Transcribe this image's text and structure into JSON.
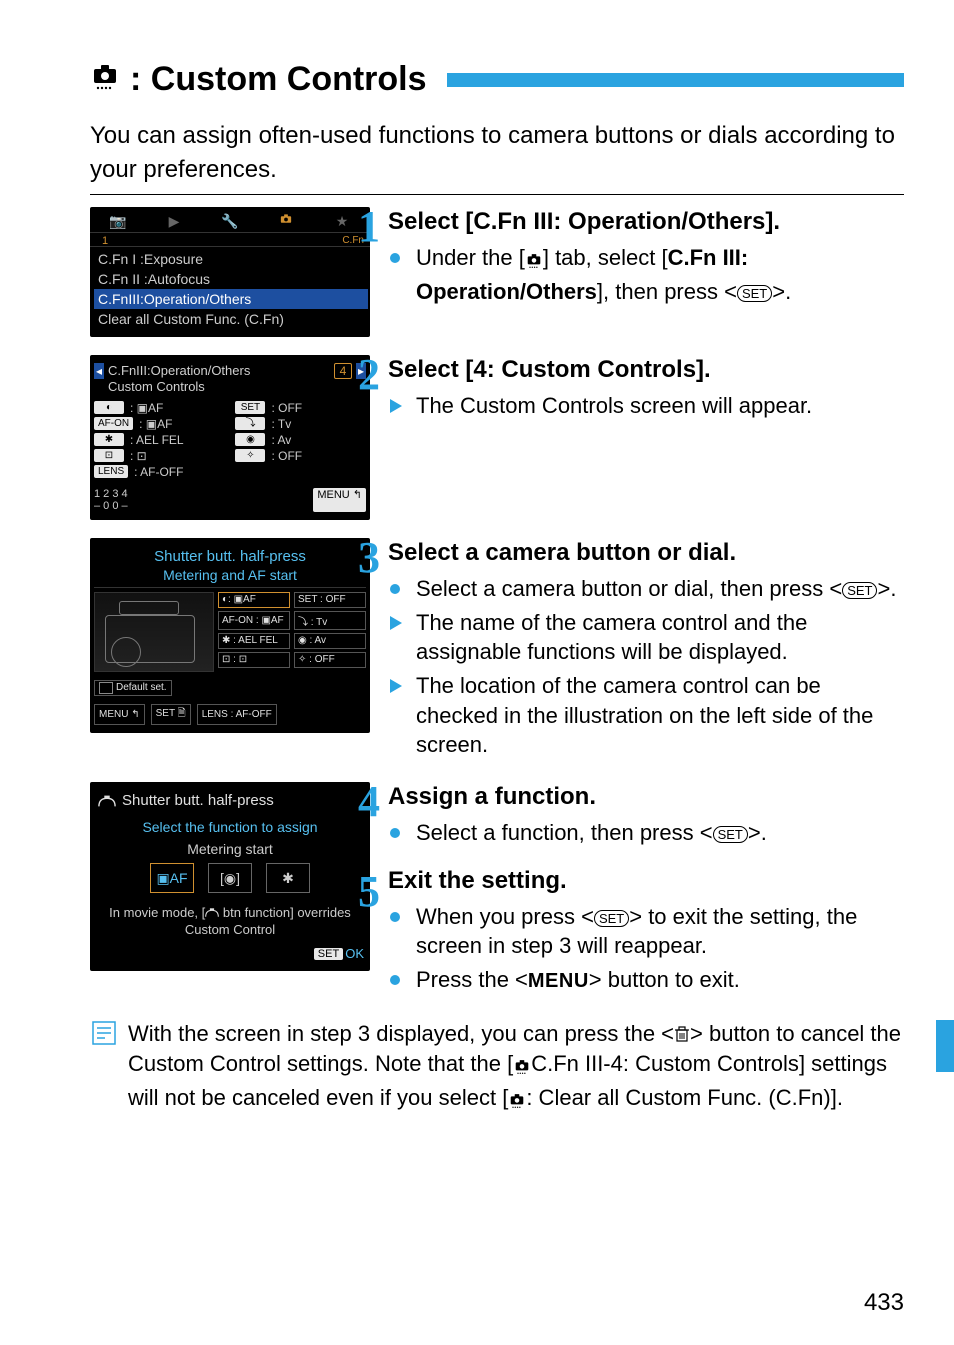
{
  "page_number": "433",
  "title_text": ": Custom Controls",
  "intro": "You can assign often-used functions to camera buttons or dials according to your preferences.",
  "icons": {
    "cfn_tab": "custom-functions-tab-icon",
    "set_button": "SET",
    "menu_button": "MENU",
    "trash": "trash-icon",
    "shutter": "shutter-half-press-icon"
  },
  "steps": [
    {
      "num": "1",
      "head": "Select [C.Fn III: Operation/Others].",
      "bullets": [
        {
          "kind": "dot",
          "pre": "Under the [",
          "mid": "] tab, select [",
          "bold": "C.Fn III: Operation/Others",
          "post": "], then press <",
          "post2": ">."
        }
      ]
    },
    {
      "num": "2",
      "head": "Select [4: Custom Controls].",
      "bullets": [
        {
          "kind": "tri",
          "text": "The Custom Controls screen will appear."
        }
      ]
    },
    {
      "num": "3",
      "head": "Select a camera button or dial.",
      "bullets": [
        {
          "kind": "dot",
          "text_a": "Select a camera button or dial, then press <",
          "text_b": ">."
        },
        {
          "kind": "tri",
          "text": "The name of the camera control and the assignable functions will be displayed."
        },
        {
          "kind": "tri",
          "text": "The location of the camera control can be checked in the illustration on the left side of the screen."
        }
      ]
    },
    {
      "num": "4",
      "head": "Assign a function.",
      "bullets": [
        {
          "kind": "dot",
          "text_a": "Select a function, then press <",
          "text_b": ">."
        }
      ]
    },
    {
      "num": "5",
      "head": "Exit the setting.",
      "bullets": [
        {
          "kind": "dot",
          "text_a": "When you press <",
          "text_b": "> to exit the setting, the screen in step 3 will reappear."
        },
        {
          "kind": "dot",
          "text_a": "Press the <",
          "menu": "MENU",
          "text_b": "> button to exit."
        }
      ]
    }
  ],
  "scr1": {
    "tabs": [
      "📷",
      "▶",
      "🔧",
      "⚙",
      "★"
    ],
    "cfn_label": "C.Fn",
    "index": "1",
    "items": [
      {
        "label": "C.Fn I :Exposure",
        "hl": false
      },
      {
        "label": "C.Fn II :Autofocus",
        "hl": false
      },
      {
        "label": "C.FnIII:Operation/Others",
        "hl": true
      },
      {
        "label": "Clear all Custom Func. (C.Fn)",
        "hl": false
      }
    ]
  },
  "scr2": {
    "title": "C.FnIII:Operation/Others\nCustom Controls",
    "page_box": "4",
    "rows": [
      {
        "l_lbl": "◐",
        "l_sep": ":",
        "l_val": "▣AF",
        "r_lbl": "SET",
        "r_sep": ":",
        "r_val": "OFF"
      },
      {
        "l_lbl": "AF-ON",
        "l_sep": ":",
        "l_val": "▣AF",
        "r_lbl": "⤵",
        "r_sep": ":",
        "r_val": "Tv"
      },
      {
        "l_lbl": "✱",
        "l_sep": ":",
        "l_val": "AEL FEL",
        "r_lbl": "◉",
        "r_sep": ":",
        "r_val": "Av"
      },
      {
        "l_lbl": "⊡",
        "l_sep": ":",
        "l_val": "⊡",
        "r_lbl": "✧",
        "r_sep": ":",
        "r_val": "OFF"
      },
      {
        "l_lbl": "LENS",
        "l_sep": ":",
        "l_val": "AF-OFF",
        "r_lbl": "",
        "r_sep": "",
        "r_val": ""
      }
    ],
    "footer_left": "1 2 3 4\n– 0 0 –",
    "footer_right": "MENU ↰"
  },
  "scr3": {
    "head": "Shutter butt. half-press",
    "sub": "Metering and AF start",
    "grid": [
      [
        {
          "t": "◐: ▣AF",
          "hl": true
        },
        {
          "t": "SET : OFF"
        }
      ],
      [
        {
          "t": "AF-ON : ▣AF"
        },
        {
          "t": "⤵ : Tv"
        }
      ],
      [
        {
          "t": "✱ : AEL FEL"
        },
        {
          "t": "◉ : Av"
        }
      ],
      [
        {
          "t": "⊡ : ⊡"
        },
        {
          "t": "✧ : OFF"
        }
      ]
    ],
    "default_label": "Default set.",
    "foot_menu": "MENU ↰",
    "foot_set": "SET 🗎",
    "foot_lens": "LENS : AF-OFF"
  },
  "scr4": {
    "head": "Shutter butt. half-press",
    "sub": "Select the function to assign",
    "label": "Metering start",
    "options": [
      "▣AF",
      "[◉]",
      "✱"
    ],
    "note_a": "In movie mode, [",
    "note_b": " btn function] overrides Custom Control",
    "set": "SET",
    "ok": "OK"
  },
  "note": {
    "a": "With the screen in step 3 displayed, you can press the <",
    "b": "> button to cancel the Custom Control settings. Note that the [",
    "c": "C.Fn III-4: Custom Controls",
    "d": "] settings will not be canceled even if you select [",
    "e": ": Clear all Custom Func. (C.Fn)",
    "f": "]."
  }
}
